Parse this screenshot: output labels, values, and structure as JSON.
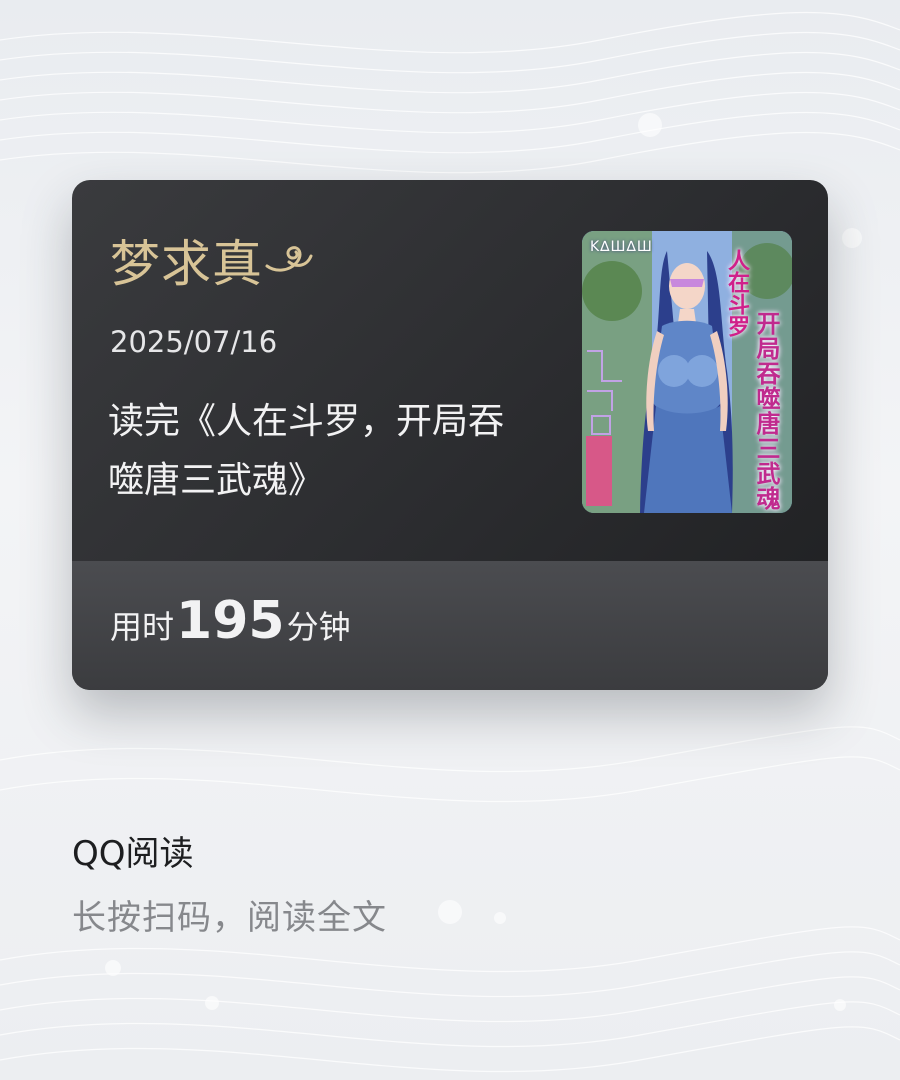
{
  "card": {
    "author": "梦求真",
    "date": "2025/07/16",
    "book_title": "读完《人在斗罗，开局吞噬唐三武魂》",
    "cover": {
      "side_text": "开局吞噬唐三武魂",
      "top_text": "人在斗罗"
    },
    "reading_time": {
      "prefix": "用时",
      "minutes": "195",
      "suffix": "分钟"
    }
  },
  "footer": {
    "app_name": "QQ阅读",
    "hint": "长按扫码，阅读全文"
  },
  "colors": {
    "author_gold": "#d8c497",
    "card_dark": "#2b2c2f",
    "hint_gray": "#86888c"
  }
}
